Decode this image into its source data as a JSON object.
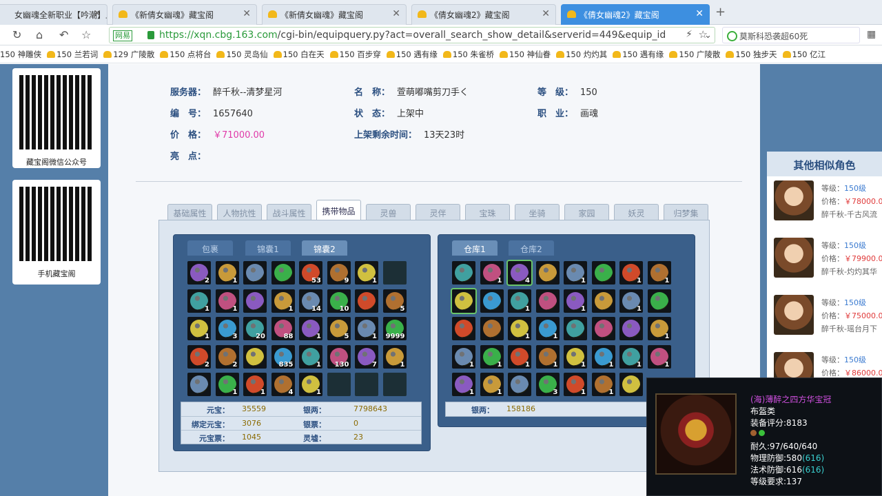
{
  "browser": {
    "tabs": [
      {
        "label": "女幽魂全新职业【吟潮】上"
      },
      {
        "label": "《新倩女幽魂》藏宝阁"
      },
      {
        "label": "《新倩女幽魂》藏宝阁"
      },
      {
        "label": "《倩女幽魂2》藏宝阁"
      },
      {
        "label": "《倩女幽魂2》藏宝阁"
      }
    ],
    "netease_badge": "网易",
    "url_host": "https://xqn.cbg.163.com",
    "url_path": "/cgi-bin/equipquery.py?act=overall_search_show_detail&serverid=449&equip_id",
    "search_text": "莫斯科恐袭超60死",
    "bookmarks": [
      "150 神雕侠",
      "150 兰若词",
      "129 广陵散",
      "150 点将台",
      "150 灵岛仙",
      "150 白在天",
      "150 百步穿",
      "150 遇有缘",
      "150 朱雀桥",
      "150 神仙眷",
      "150 灼灼其",
      "150 遇有缘",
      "150 广陵散",
      "150 独步天",
      "150 亿江"
    ]
  },
  "qr": [
    {
      "caption": "藏宝阁微信公众号"
    },
    {
      "caption": "手机藏宝阁"
    }
  ],
  "info": {
    "server_label": "服务器：",
    "server": "醉千秋--清梦星河",
    "name_label": "名　称：",
    "name": "萱萌嘟嘴剪刀手く",
    "level_label": "等　级：",
    "level": "150",
    "id_label": "编　号：",
    "id": "1657640",
    "status_label": "状　态：",
    "status": "上架中",
    "job_label": "职　业：",
    "job": "画魂",
    "price_label": "价　格：",
    "price": "￥71000.00",
    "remain_label": "上架剩余时间：",
    "remain": "13天23时",
    "highlight_label": "亮　点："
  },
  "game_tabs": [
    "基础属性",
    "人物抗性",
    "战斗属性",
    "携带物品",
    "灵兽",
    "灵伴",
    "宝珠",
    "坐骑",
    "家园",
    "妖灵",
    "归梦集"
  ],
  "active_game_tab": 3,
  "bag": {
    "tabs": [
      "包裹",
      "锦囊1",
      "锦囊2"
    ],
    "active": 2,
    "counts": [
      "2",
      "1",
      "",
      "",
      "53",
      "9",
      "1",
      "",
      "1",
      "1",
      "",
      "1",
      "14",
      "10",
      "",
      "5",
      "1",
      "3",
      "20",
      "88",
      "1",
      "5",
      "1",
      "9999",
      "2",
      "2",
      "",
      "835",
      "1",
      "130",
      "7",
      "1",
      "",
      "1",
      "1",
      "4",
      "1",
      "",
      "",
      ""
    ],
    "money": [
      {
        "label": "元宝：",
        "value": "35559",
        "label2": "银两：",
        "value2": "7798643"
      },
      {
        "label": "绑定元宝：",
        "value": "3076",
        "label2": "银票：",
        "value2": "0"
      },
      {
        "label": "元宝票：",
        "value": "1045",
        "label2": "灵墟：",
        "value2": "23"
      }
    ]
  },
  "warehouse": {
    "tabs": [
      "仓库1",
      "仓库2"
    ],
    "active": 0,
    "counts": [
      "",
      "1",
      "4",
      "",
      "1",
      "",
      "1",
      "1",
      "",
      "",
      "1",
      "",
      "1",
      "",
      "1",
      "",
      "",
      "",
      "1",
      "1",
      "",
      "",
      "",
      "1",
      "1",
      "1",
      "1",
      "1",
      "1",
      "1",
      "1",
      "1",
      "1",
      "1",
      "",
      "3",
      "1",
      "1",
      ""
    ],
    "money_label": "银两：",
    "money_value": "158186"
  },
  "similar": {
    "title": "其他相似角色",
    "items": [
      {
        "level_label": "等级：",
        "level": "150级",
        "price_label": "价格：",
        "price": "￥78000.0",
        "server": "醉千秋-千古风流"
      },
      {
        "level_label": "等级：",
        "level": "150级",
        "price_label": "价格：",
        "price": "￥79900.0",
        "server": "醉千秋-灼灼其华"
      },
      {
        "level_label": "等级：",
        "level": "150级",
        "price_label": "价格：",
        "price": "￥75000.0",
        "server": "醉千秋-瑶台月下"
      },
      {
        "level_label": "等级：",
        "level": "150级",
        "price_label": "价格：",
        "price": "￥86000.0",
        "server": ""
      }
    ]
  },
  "tooltip": {
    "name": "(海)薄醉之四方华宝冠",
    "type": "布盔类",
    "score": "装备评分:8183",
    "durability": "耐久:97/640/640",
    "phys_def": "物理防御:580",
    "phys_def_bonus": "(616)",
    "mag_def": "法术防御:616",
    "mag_def_bonus": "(616)",
    "req_level": "等级要求:137"
  },
  "colors": {
    "accent": "#3d8fe0",
    "panel": "#557fa9",
    "price": "#e03aa8"
  }
}
